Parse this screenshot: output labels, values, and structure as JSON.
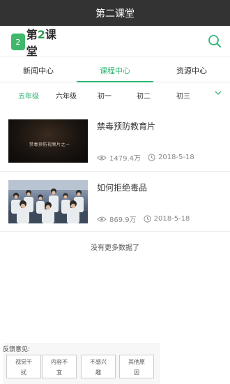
{
  "app": {
    "title": "第二课堂"
  },
  "header": {
    "logo_badge": "2",
    "logo_prefix": "第",
    "logo_num": "2",
    "logo_suffix": "课堂"
  },
  "tabs": [
    {
      "label": "新闻中心",
      "active": false
    },
    {
      "label": "课程中心",
      "active": true
    },
    {
      "label": "资源中心",
      "active": false
    }
  ],
  "grades": [
    "五年级",
    "六年级",
    "初一",
    "初二",
    "初三"
  ],
  "items": [
    {
      "title": "禁毒预防教育片",
      "thumb_caption": "禁毒预防视频片之一",
      "views": "1479.4万",
      "date": "2018-5-18"
    },
    {
      "title": "如何拒绝毒品",
      "views": "869.9万",
      "date": "2018-5-18"
    }
  ],
  "footer": {
    "no_more": "没有更多数据了"
  },
  "feedback": {
    "label": "反馈意见:",
    "options": [
      {
        "line1": "视觉干",
        "line2": "扰"
      },
      {
        "line1": "内容不",
        "line2": "宜"
      },
      {
        "line1": "不感兴",
        "line2": "趣"
      },
      {
        "line1": "其他原",
        "line2": "因"
      }
    ]
  },
  "colors": {
    "accent": "#2fb673",
    "titlebar": "#333333"
  }
}
